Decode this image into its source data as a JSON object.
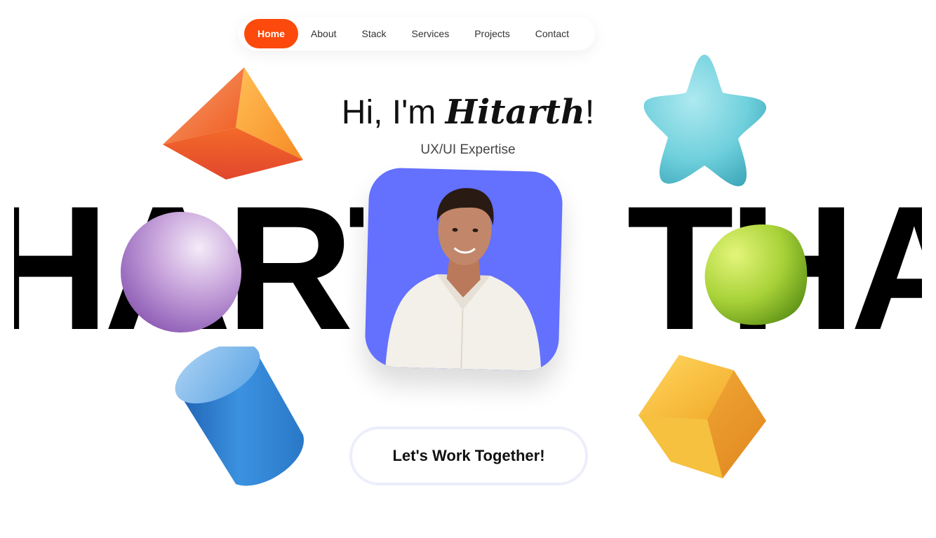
{
  "nav": {
    "items": [
      {
        "label": "Home",
        "active": true
      },
      {
        "label": "About"
      },
      {
        "label": "Stack"
      },
      {
        "label": "Services"
      },
      {
        "label": "Projects"
      },
      {
        "label": "Contact"
      }
    ]
  },
  "hero": {
    "greeting_prefix": "Hi, I'm ",
    "name": "Hitarth",
    "greeting_suffix": "!",
    "subtitle": "UX/UI Expertise",
    "background_text_left": "HARTH",
    "background_text_right": "THA",
    "cta_label": "Let's Work Together!"
  },
  "colors": {
    "accent": "#fb4a0b",
    "portrait_bg": "#6470fe"
  },
  "decor": {
    "shapes": [
      "pyramid-icon",
      "star-icon",
      "sphere-icon",
      "rounded-cube-icon",
      "cylinder-icon",
      "cube-icon"
    ]
  }
}
